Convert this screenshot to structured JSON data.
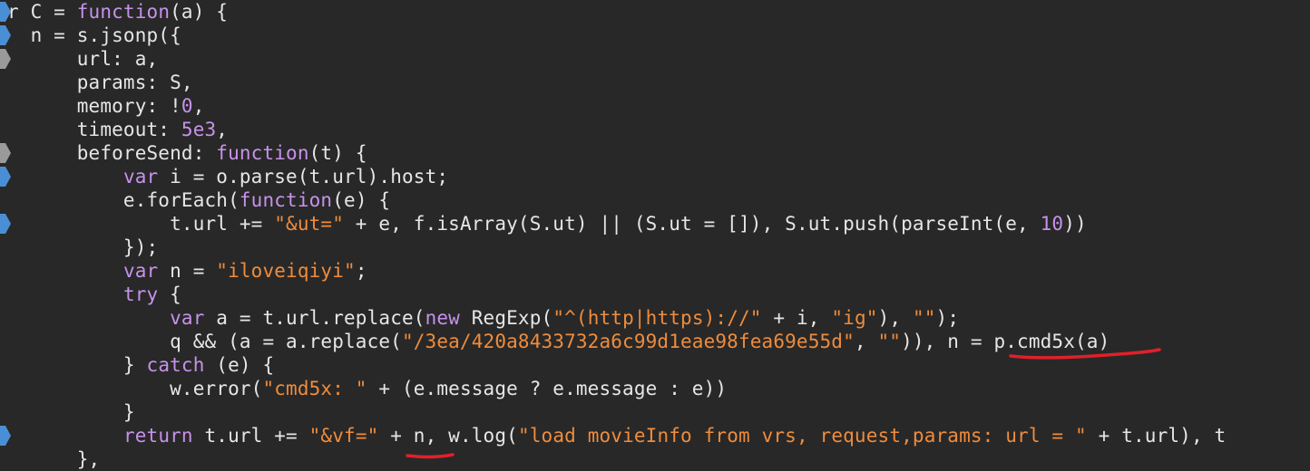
{
  "editor": {
    "colors": {
      "background": "#282828",
      "identifier": "#e6e6e6",
      "keyword": "#c792ea",
      "string": "#ef8c3c",
      "number": "#c792ea",
      "breakpoint_active": "#4a8fd6",
      "breakpoint_inactive": "#9a9a9a",
      "annotation": "#e0202a"
    },
    "lines": [
      [
        {
          "t": "r C = ",
          "c": "id"
        },
        {
          "t": "function",
          "c": "kw"
        },
        {
          "t": "(a) {",
          "c": "id"
        }
      ],
      [
        {
          "t": "  n = s.jsonp({",
          "c": "id"
        }
      ],
      [
        {
          "t": "      url: a,",
          "c": "id"
        }
      ],
      [
        {
          "t": "      params: S,",
          "c": "id"
        }
      ],
      [
        {
          "t": "      memory: !",
          "c": "id"
        },
        {
          "t": "0",
          "c": "num"
        },
        {
          "t": ",",
          "c": "id"
        }
      ],
      [
        {
          "t": "      timeout: ",
          "c": "id"
        },
        {
          "t": "5e3",
          "c": "num"
        },
        {
          "t": ",",
          "c": "id"
        }
      ],
      [
        {
          "t": "      beforeSend: ",
          "c": "id"
        },
        {
          "t": "function",
          "c": "kw"
        },
        {
          "t": "(t) {",
          "c": "id"
        }
      ],
      [
        {
          "t": "          ",
          "c": "id"
        },
        {
          "t": "var",
          "c": "kw"
        },
        {
          "t": " i = o.parse(t.url).host;",
          "c": "id"
        }
      ],
      [
        {
          "t": "          e.forEach(",
          "c": "id"
        },
        {
          "t": "function",
          "c": "kw"
        },
        {
          "t": "(e) {",
          "c": "id"
        }
      ],
      [
        {
          "t": "              t.url += ",
          "c": "id"
        },
        {
          "t": "\"&ut=\"",
          "c": "str"
        },
        {
          "t": " + e, f.isArray(S.ut) || (S.ut = []), S.ut.push(parseInt(e, ",
          "c": "id"
        },
        {
          "t": "10",
          "c": "num"
        },
        {
          "t": "))",
          "c": "id"
        }
      ],
      [
        {
          "t": "          });",
          "c": "id"
        }
      ],
      [
        {
          "t": "          ",
          "c": "id"
        },
        {
          "t": "var",
          "c": "kw"
        },
        {
          "t": " n = ",
          "c": "id"
        },
        {
          "t": "\"iloveiqiyi\"",
          "c": "str"
        },
        {
          "t": ";",
          "c": "id"
        }
      ],
      [
        {
          "t": "          ",
          "c": "id"
        },
        {
          "t": "try",
          "c": "kw"
        },
        {
          "t": " {",
          "c": "id"
        }
      ],
      [
        {
          "t": "              ",
          "c": "id"
        },
        {
          "t": "var",
          "c": "kw"
        },
        {
          "t": " a = t.url.replace(",
          "c": "id"
        },
        {
          "t": "new",
          "c": "kw"
        },
        {
          "t": " RegExp(",
          "c": "id"
        },
        {
          "t": "\"^(http|https)://\"",
          "c": "str"
        },
        {
          "t": " + i, ",
          "c": "id"
        },
        {
          "t": "\"ig\"",
          "c": "str"
        },
        {
          "t": "), ",
          "c": "id"
        },
        {
          "t": "\"\"",
          "c": "str"
        },
        {
          "t": ");",
          "c": "id"
        }
      ],
      [
        {
          "t": "              q && (a = a.replace(",
          "c": "id"
        },
        {
          "t": "\"/3ea/420a8433732a6c99d1eae98fea69e55d\"",
          "c": "str"
        },
        {
          "t": ", ",
          "c": "id"
        },
        {
          "t": "\"\"",
          "c": "str"
        },
        {
          "t": ")), n = p.cmd5x(a)",
          "c": "id"
        }
      ],
      [
        {
          "t": "          } ",
          "c": "id"
        },
        {
          "t": "catch",
          "c": "kw"
        },
        {
          "t": " (e) {",
          "c": "id"
        }
      ],
      [
        {
          "t": "              w.error(",
          "c": "id"
        },
        {
          "t": "\"cmd5x: \"",
          "c": "str"
        },
        {
          "t": " + (e.message ? e.message : e))",
          "c": "id"
        }
      ],
      [
        {
          "t": "          }",
          "c": "id"
        }
      ],
      [
        {
          "t": "          ",
          "c": "id"
        },
        {
          "t": "return",
          "c": "kw"
        },
        {
          "t": " t.url += ",
          "c": "id"
        },
        {
          "t": "\"&vf=\"",
          "c": "str"
        },
        {
          "t": " + n, w.log(",
          "c": "id"
        },
        {
          "t": "\"load movieInfo from vrs, request,params: url = \"",
          "c": "str"
        },
        {
          "t": " + t.url), t",
          "c": "id"
        }
      ],
      [
        {
          "t": "      },",
          "c": "id"
        }
      ]
    ],
    "breakpoint_lines": [
      {
        "line": 0,
        "state": "active"
      },
      {
        "line": 1,
        "state": "active"
      },
      {
        "line": 2,
        "state": "inactive"
      },
      {
        "line": 6,
        "state": "inactive"
      },
      {
        "line": 7,
        "state": "active"
      },
      {
        "line": 9,
        "state": "active"
      },
      {
        "line": 18,
        "state": "active"
      }
    ]
  }
}
